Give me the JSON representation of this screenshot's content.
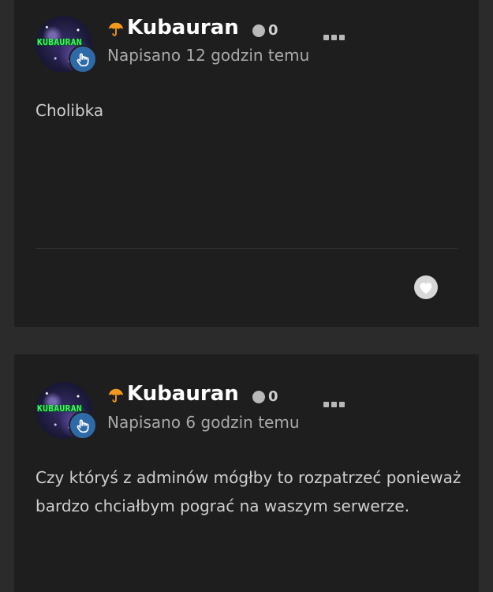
{
  "posts": [
    {
      "avatar_text": "KUBAURAN",
      "username": "Kubauran",
      "reputation": "0",
      "posted": "Napisano 12 godzin temu",
      "body": "Cholibka"
    },
    {
      "avatar_text": "KUBAURAN",
      "username": "Kubauran",
      "reputation": "0",
      "posted": "Napisano 6 godzin temu",
      "body": "Czy któryś z adminów mógłby to rozpatrzeć ponieważ bardzo chciałbym pograć na waszym serwerze."
    }
  ],
  "icons": {
    "badge": "hand-icon",
    "group": "umbrella-icon",
    "menu": "more-options-icon",
    "reaction": "heart-icon"
  },
  "colors": {
    "page_bg": "#2b2b2b",
    "card_bg": "#1e1e1e",
    "badge_blue": "#2f6aa8",
    "umbrella_orange": "#f39a1e",
    "avatar_text_green": "#3cff5a"
  }
}
